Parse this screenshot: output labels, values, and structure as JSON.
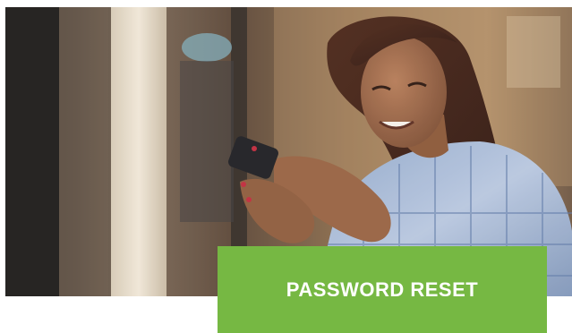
{
  "banner": {
    "title": "PASSWORD RESET",
    "background_color": "#76b843",
    "text_color": "#ffffff"
  },
  "hero": {
    "icon": "photo-woman-using-smartphone"
  }
}
